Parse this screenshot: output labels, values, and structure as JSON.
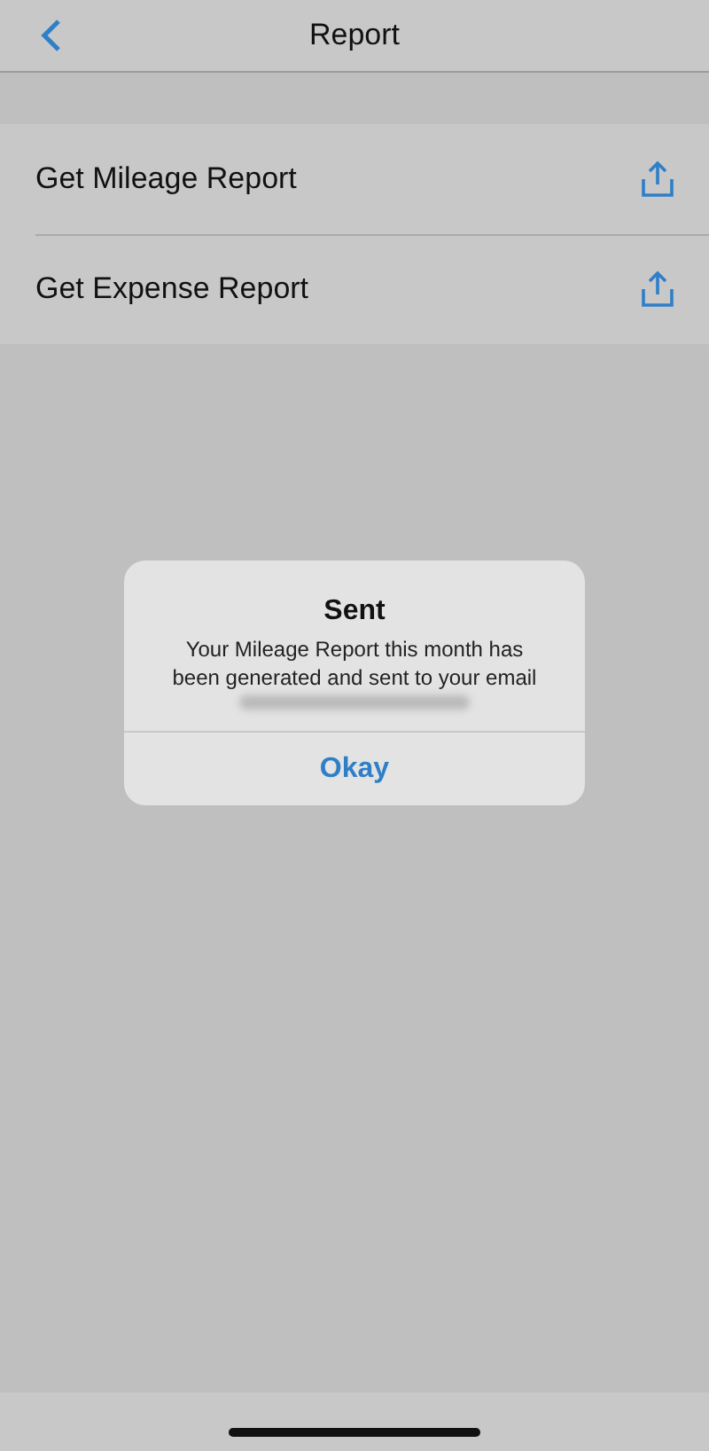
{
  "nav_bar": {
    "title": "Report"
  },
  "rows": [
    {
      "label": "Get Mileage Report"
    },
    {
      "label": "Get Expense Report"
    }
  ],
  "alert": {
    "title": "Sent",
    "message": "Your Mileage Report this month has been generated and sent to your email",
    "button": "Okay"
  }
}
